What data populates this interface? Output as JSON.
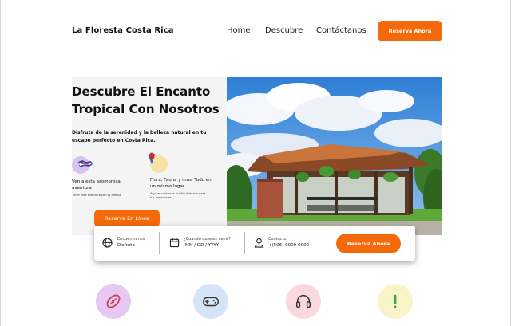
{
  "header": {
    "brand": "La Floresta Costa Rica",
    "nav": [
      "Home",
      "Descubre",
      "Contáctanos"
    ],
    "cta": "Reserva Ahora"
  },
  "hero": {
    "title": "Descubre El Encanto Tropical Con Nosotros",
    "subtitle": "Disfruta de la serenidad y la belleza natural en tu escape perfecto en Costa Rica.",
    "features": [
      {
        "icon": "costa-rica-flag-icon",
        "title": "Ven a esta asombrosa aventura",
        "small": "Vive esta aventura con tu familia"
      },
      {
        "icon": "parrot-icon",
        "title": "Flora, Fauna y más. Todo en un mismo lugar",
        "small": "Aquí encontrarás el sitio indicado para tus vacaciones"
      }
    ],
    "cta": "Reserva En Línea"
  },
  "booking": {
    "location_label": "Encuéntranos",
    "location_value": "Disfruta",
    "date_label": "¿Cuando quieres venir?",
    "date_placeholder": "MM / DD / YYYY",
    "contact_label": "Contacto",
    "contact_value": "+(506) 0000-0000",
    "cta": "Reserva Ahora"
  },
  "services": [
    {
      "icon": "football-icon",
      "color": "#e7c8f2"
    },
    {
      "icon": "gamepad-icon",
      "color": "#d5e5f7"
    },
    {
      "icon": "headphones-icon",
      "color": "#f9d9df"
    },
    {
      "icon": "exclamation-icon",
      "color": "#f9f3c8"
    }
  ],
  "colors": {
    "accent": "#f46a0a"
  }
}
